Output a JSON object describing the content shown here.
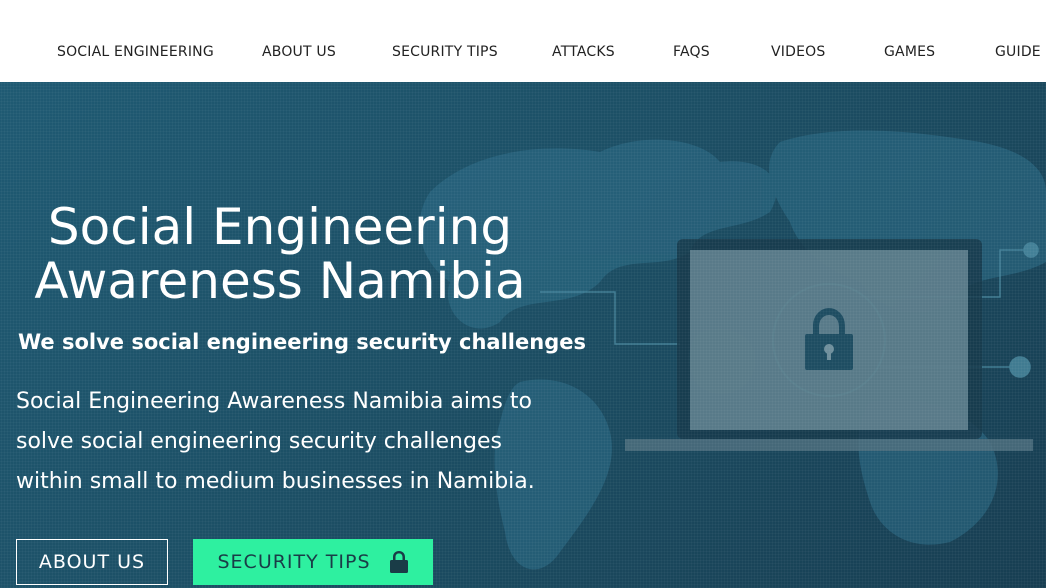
{
  "nav": {
    "items": [
      {
        "label": "SOCIAL ENGINEERING"
      },
      {
        "label": "ABOUT US"
      },
      {
        "label": "SECURITY TIPS"
      },
      {
        "label": "ATTACKS"
      },
      {
        "label": "FAQS"
      },
      {
        "label": "VIDEOS"
      },
      {
        "label": "GAMES"
      },
      {
        "label": "GUIDE"
      }
    ]
  },
  "hero": {
    "title_line1": "Social Engineering",
    "title_line2": "Awareness Namibia",
    "subtitle": "We solve social engineering security challenges",
    "description": "Social Engineering Awareness Namibia aims to solve social engineering security challenges within small to medium businesses in Namibia.",
    "buttons": {
      "about_label": "ABOUT US",
      "tips_label": "SECURITY TIPS",
      "tips_icon": "lock-icon"
    },
    "illustration_icons": [
      "world-map",
      "laptop-icon",
      "padlock-icon"
    ]
  },
  "colors": {
    "hero_bg": "#1f5a73",
    "accent_green": "#2ef0a0",
    "nav_text": "#222222"
  }
}
